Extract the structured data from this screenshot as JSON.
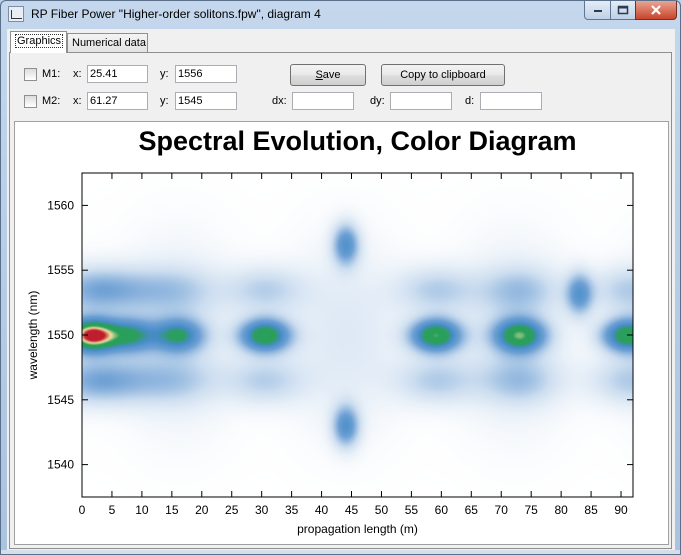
{
  "window": {
    "title": "RP Fiber Power \"Higher-order solitons.fpw\", diagram 4"
  },
  "tabs": [
    {
      "label": "Graphics",
      "active": true
    },
    {
      "label": "Numerical data",
      "active": false
    }
  ],
  "markers": {
    "m1": {
      "label": "M1:",
      "x_label": "x:",
      "x_value": "25.41",
      "y_label": "y:",
      "y_value": "1556",
      "checked": false
    },
    "m2": {
      "label": "M2:",
      "x_label": "x:",
      "x_value": "61.27",
      "y_label": "y:",
      "y_value": "1545",
      "checked": false
    }
  },
  "deltas": {
    "dx_label": "dx:",
    "dx_value": "",
    "dy_label": "dy:",
    "dy_value": "",
    "d_label": "d:",
    "d_value": ""
  },
  "buttons": {
    "save_label": "Save",
    "save_underline": "S",
    "copy_label": "Copy to clipboard"
  },
  "chart_data": {
    "type": "heatmap",
    "title": "Spectral Evolution, Color Diagram",
    "xlabel": "propagation length (m)",
    "ylabel": "wavelength (nm)",
    "xlim": [
      0,
      92
    ],
    "ylim": [
      1537.5,
      1562.5
    ],
    "x_ticks": [
      0,
      5,
      10,
      15,
      20,
      25,
      30,
      35,
      40,
      45,
      50,
      55,
      60,
      65,
      70,
      75,
      80,
      85,
      90
    ],
    "y_ticks": [
      1540,
      1545,
      1550,
      1555,
      1560
    ],
    "colormap": [
      "#ffffff",
      "#b3cce6",
      "#5a90c8",
      "#2f9c5a",
      "#f5e6a8",
      "#c0282d"
    ],
    "grid": false,
    "blobs": [
      {
        "x": 1.5,
        "y": 1550,
        "intensity": 1.0
      },
      {
        "x": 8,
        "y": 1550,
        "intensity": 0.55
      },
      {
        "x": 16,
        "y": 1550,
        "intensity": 0.55
      },
      {
        "x": 30.5,
        "y": 1550,
        "intensity": 0.75
      },
      {
        "x": 59,
        "y": 1550,
        "intensity": 0.78
      },
      {
        "x": 73,
        "y": 1550,
        "intensity": 0.72
      },
      {
        "x": 91,
        "y": 1550,
        "intensity": 0.72
      },
      {
        "x": 44,
        "y": 1557,
        "intensity": 0.45
      },
      {
        "x": 44,
        "y": 1543,
        "intensity": 0.45
      },
      {
        "x": 83,
        "y": 1553.2,
        "intensity": 0.4
      }
    ]
  }
}
